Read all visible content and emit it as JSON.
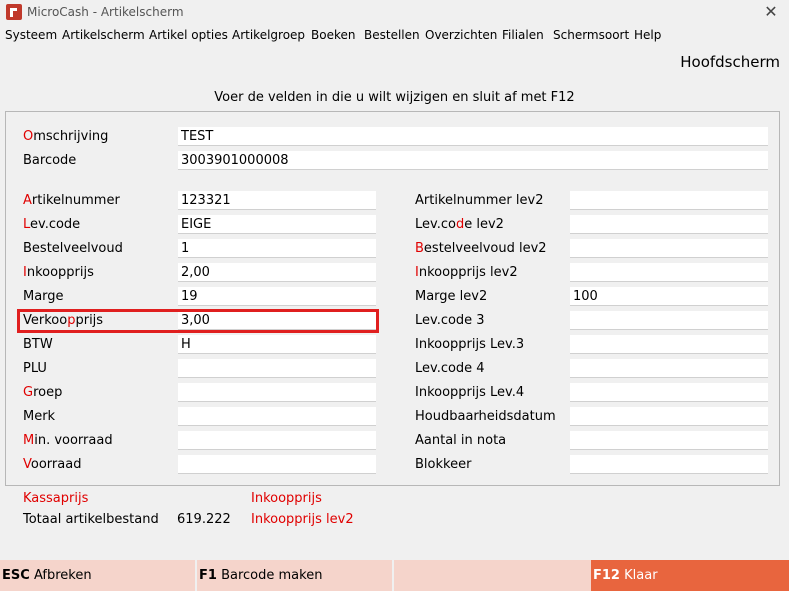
{
  "window": {
    "title": "MicroCash - Artikelscherm"
  },
  "menu": [
    "Systeem",
    "Artikelscherm",
    "Artikel opties",
    "Artikelgroep",
    "Boeken",
    "Bestellen",
    "Overzichten",
    "Filialen",
    "Schermsoort",
    "Help"
  ],
  "screen_name": "Hoofdscherm",
  "instruction": "Voer de velden in die u wilt wijzigen en sluit af met F12",
  "fields": {
    "omschrijving": {
      "hk": "O",
      "rest": "mschrijving",
      "value": "TEST"
    },
    "barcode": {
      "label": "Barcode",
      "value": "3003901000008"
    },
    "artikelnummer": {
      "hk": "A",
      "rest": "rtikelnummer",
      "value": "123321"
    },
    "levcode": {
      "hk": "L",
      "rest": "ev.code",
      "value": "EIGE"
    },
    "bestelveelvoud": {
      "label": "Bestelveelvoud",
      "value": "1"
    },
    "inkoopprijs": {
      "hk": "I",
      "rest": "nkoopprijs",
      "value": "2,00"
    },
    "marge": {
      "label": "Marge",
      "value": "19"
    },
    "verkoopprijs": {
      "pre": "Verkoo",
      "hk": "p",
      "post": "prijs",
      "value": "3,00"
    },
    "btw": {
      "label": "BTW",
      "value": "H"
    },
    "plu": {
      "label": "PLU",
      "value": ""
    },
    "groep": {
      "hk": "G",
      "rest": "roep",
      "value": ""
    },
    "merk": {
      "label": "Merk",
      "value": ""
    },
    "minvoorraad": {
      "hk": "M",
      "rest": "in. voorraad",
      "value": ""
    },
    "voorraad": {
      "hk": "V",
      "rest": "oorraad",
      "value": ""
    },
    "artikelnummer_lev2": {
      "label": "Artikelnummer lev2",
      "value": ""
    },
    "levcode_lev2": {
      "pre": "Lev.co",
      "hk": "d",
      "post": "e lev2",
      "value": ""
    },
    "bestelveelvoud_lev2": {
      "hk": "B",
      "rest": "estelveelvoud lev2",
      "value": ""
    },
    "inkoopprijs_lev2": {
      "hk": "I",
      "rest": "nkoopprijs lev2",
      "value": ""
    },
    "marge_lev2": {
      "label": "Marge lev2",
      "value": "100"
    },
    "levcode3": {
      "label": "Lev.code 3",
      "value": ""
    },
    "inkoopprijs_lev3": {
      "label": "Inkoopprijs Lev.3",
      "value": ""
    },
    "levcode4": {
      "label": "Lev.code 4",
      "value": ""
    },
    "inkoopprijs_lev4": {
      "label": "Inkoopprijs Lev.4",
      "value": ""
    },
    "houdbaarheidsdatum": {
      "label": "Houdbaarheidsdatum",
      "value": ""
    },
    "aantal_in_nota": {
      "label": "Aantal in nota",
      "value": ""
    },
    "blokkeer": {
      "label": "Blokkeer",
      "value": ""
    }
  },
  "summary": {
    "kassaprijs": "Kassaprijs",
    "totaal_label": "Totaal artikelbestand",
    "totaal_value": "619.222",
    "inkoopprijs": "Inkoopprijs",
    "inkoopprijs_lev2": "Inkoopprijs lev2"
  },
  "fkeys": [
    {
      "key": "ESC",
      "label": "Afbreken"
    },
    {
      "key": "F1",
      "label": "Barcode maken"
    },
    {
      "key": "",
      "label": ""
    },
    {
      "key": "F12",
      "label": "Klaar"
    }
  ],
  "colors": {
    "hotkey": "#e00000",
    "highlight": "#e01f1f",
    "fkey_bar": "#f5d4cb",
    "fkey_primary": "#e8653e"
  }
}
